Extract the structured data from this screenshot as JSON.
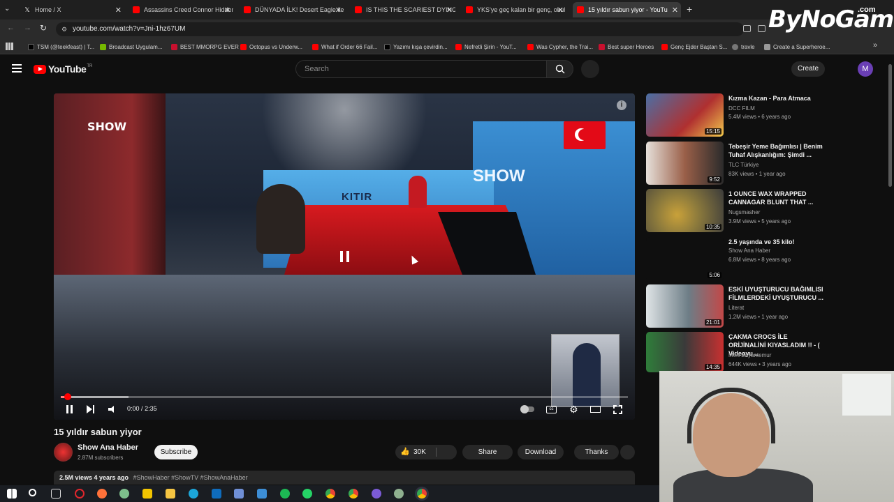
{
  "browser": {
    "tabs": [
      {
        "title": "Home / X",
        "color": "#1d1d1d"
      },
      {
        "title": "Assassins Creed Connor Hidden",
        "color": "#ff0000"
      },
      {
        "title": "DÜNYADA İLK! Desert Eagle ile",
        "color": "#ff0000"
      },
      {
        "title": "IS THIS THE SCARIEST DYING LI",
        "color": "#ff0000"
      },
      {
        "title": "YKS'ye geç kalan bir genç, okul",
        "color": "#ff0000"
      },
      {
        "title": "15 yıldır sabun yiyor - YouTu",
        "color": "#ff0000"
      }
    ],
    "url": "youtube.com/watch?v=Jni-1hz67UM",
    "bookmarks": [
      "TSM (@teekfeast) | T...",
      "Broadcast Uygulam...",
      "BEST MMORPG EVER",
      "Octopus vs Underw...",
      "What if Order 66 Fail...",
      "Yazımı kışa çevirdin...",
      "Nefretli Şirin - YouT...",
      "Was Cypher, the Trai...",
      "Best super Heroes",
      "Genç Ejder Baştan S...",
      "travle",
      "Create a Superheroe..."
    ]
  },
  "header": {
    "logo": "YouTube",
    "logo_region": "TR",
    "search_placeholder": "Search",
    "create_label": "Create",
    "avatar_letter": "M"
  },
  "video": {
    "overlay_show": "SHOW",
    "overlay_kitir": "KITIR",
    "overlay_show_big": "SHOW",
    "progress": 0.0,
    "buffered": 0.12,
    "time_current": "0:00",
    "time_total": "2:35",
    "title": "15 yıldır sabun yiyor"
  },
  "channel": {
    "name": "Show Ana Haber",
    "subscribers": "2.87M subscribers",
    "subscribe_label": "Subscribe"
  },
  "actions": {
    "likes": "30K",
    "share": "Share",
    "download": "Download",
    "thanks": "Thanks"
  },
  "description": {
    "meta": "2.5M views 4 years ago",
    "tags": "#ShowHaber #ShowTV #ShowAnaHaber"
  },
  "recommendations": [
    {
      "title": "Kızma Kazan - Para Atmaca",
      "channel": "DCC FILM",
      "meta": "5.4M views • 6 years ago",
      "duration": "15:15",
      "thumb": "#b03030"
    },
    {
      "title": "Tebeşir Yeme Bağımlısı | Benim Tuhaf Alışkanlığım: Şimdi ...",
      "channel": "TLC Türkiye",
      "meta": "83K views • 1 year ago",
      "duration": "9:52",
      "thumb": "#9a5f48"
    },
    {
      "title": "1 OUNCE WAX WRAPPED CANNAGAR BLUNT THAT ...",
      "channel": "Nugsmasher",
      "meta": "3.9M views • 5 years ago",
      "duration": "10:35",
      "thumb": "#8c7a3c"
    },
    {
      "title": "2.5 yaşında ve 35 kilo!",
      "channel": "Show Ana Haber",
      "meta": "6.8M views • 8 years ago",
      "duration": "5:06",
      "thumb": "#0f0f0f"
    },
    {
      "title": "ESKİ UYUŞTURUCU BAĞIMLISI FİLMLERDEKİ UYUŞTURUCU ...",
      "channel": "Literat",
      "meta": "1.2M views • 1 year ago",
      "duration": "21:01",
      "thumb": "#6d7d86"
    },
    {
      "title": "ÇAKMA CROCS İLE ORİJİNALİNİ KIYASLADIM !! - ( Videoyu ...",
      "channel": "Mert Bayantemur",
      "meta": "644K views • 3 years ago",
      "duration": "14:35",
      "thumb": "#2f7d3a"
    }
  ],
  "watermark": {
    "text": "ByNoGame",
    "suffix": ".com"
  },
  "colors": {
    "accent": "#ff0000",
    "background": "#0f0f0f"
  }
}
